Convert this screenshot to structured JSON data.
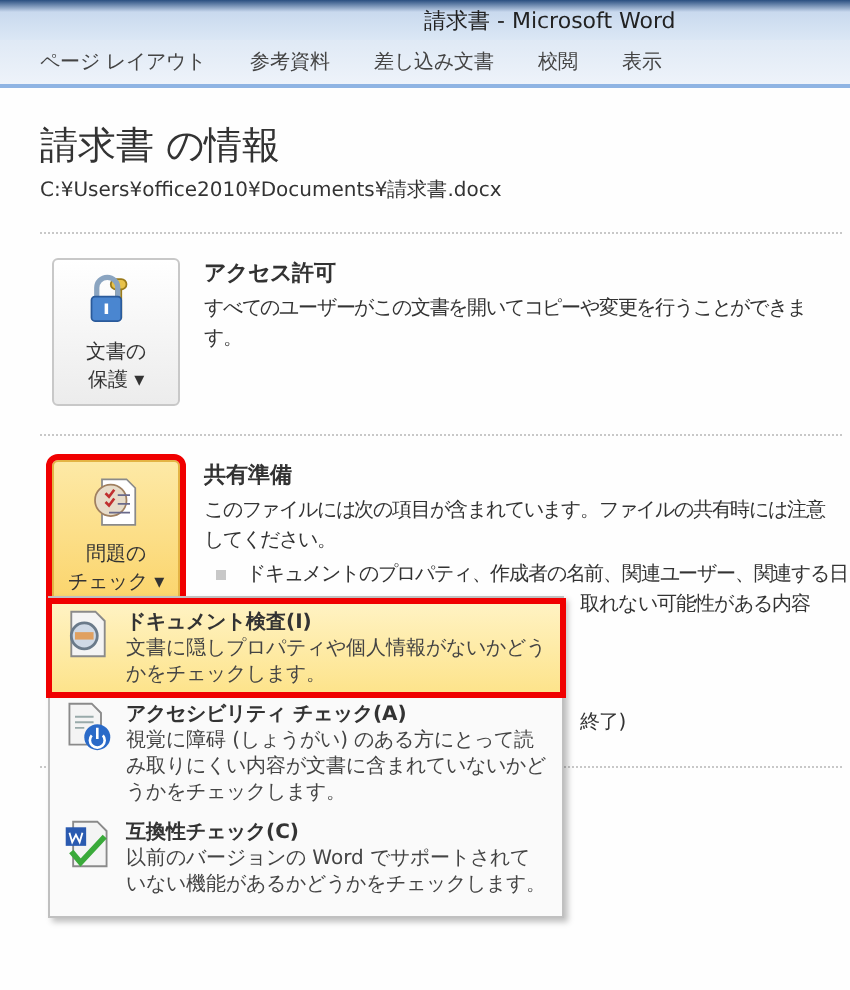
{
  "window": {
    "title": "請求書 - Microsoft Word"
  },
  "tabs": [
    {
      "label": "ページ レイアウト",
      "selected": false
    },
    {
      "label": "参考資料",
      "selected": false
    },
    {
      "label": "差し込み文書",
      "selected": false
    },
    {
      "label": "校閲",
      "selected": false
    },
    {
      "label": "表示",
      "selected": false
    }
  ],
  "info": {
    "heading": "請求書 の情報",
    "path": "C:¥Users¥office2010¥Documents¥請求書.docx"
  },
  "sections": [
    {
      "kind": "protect",
      "button": {
        "label_lines": [
          "文書の",
          "保護 ▾"
        ],
        "highlighted": false,
        "marked": false
      },
      "title": "アクセス許可",
      "description": "すべてのユーザーがこの文書を開いてコピーや変更を行うことができます。"
    },
    {
      "kind": "check",
      "button": {
        "label_lines": [
          "問題の",
          "チェック ▾"
        ],
        "highlighted": true,
        "marked": true
      },
      "title": "共有準備",
      "description": "このファイルには次の項目が含まれています。ファイルの共有時には注意してください。",
      "bullets": [
        "ドキュメントのプロパティ、作成者の名前、関連ユーザー、関連する日"
      ],
      "fragments": [
        "取れない可能性がある内容",
        "終了)"
      ]
    }
  ],
  "menu": {
    "items": [
      {
        "kind": "inspect",
        "title": "ドキュメント検査(I)",
        "description": "文書に隠しプロパティや個人情報がないかどうかをチェックします。",
        "selected": true,
        "marked": true
      },
      {
        "kind": "accessibility",
        "title": "アクセシビリティ チェック(A)",
        "description": "視覚に障碍 (しょうがい) のある方にとって読み取りにくい内容が文書に含まれていないかどうかをチェックします。",
        "selected": false,
        "marked": false
      },
      {
        "kind": "compat",
        "title": "互換性チェック(C)",
        "description": "以前のバージョンの Word でサポートされていない機能があるかどうかをチェックします。",
        "selected": false,
        "marked": false
      }
    ]
  }
}
